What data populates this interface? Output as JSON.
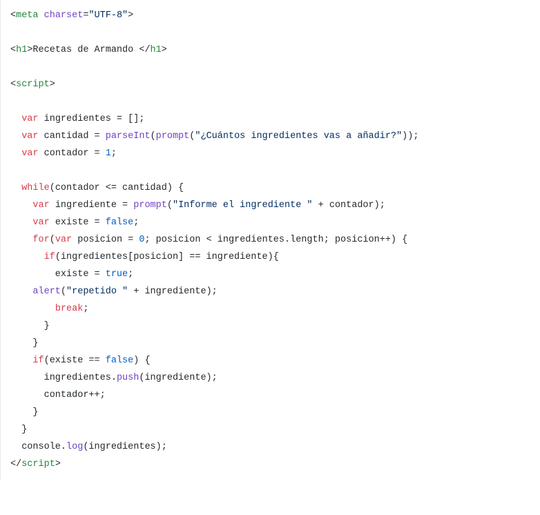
{
  "code": {
    "lines": [
      [
        {
          "c": "c-default",
          "t": "<"
        },
        {
          "c": "c-tag",
          "t": "meta"
        },
        {
          "c": "c-default",
          "t": " "
        },
        {
          "c": "c-attr",
          "t": "charset"
        },
        {
          "c": "c-default",
          "t": "="
        },
        {
          "c": "c-str",
          "t": "\"UTF-8\""
        },
        {
          "c": "c-default",
          "t": ">"
        }
      ],
      [],
      [
        {
          "c": "c-default",
          "t": "<"
        },
        {
          "c": "c-tag",
          "t": "h1"
        },
        {
          "c": "c-default",
          "t": ">Recetas de Armando </"
        },
        {
          "c": "c-tag",
          "t": "h1"
        },
        {
          "c": "c-default",
          "t": ">"
        }
      ],
      [],
      [
        {
          "c": "c-default",
          "t": "<"
        },
        {
          "c": "c-tag",
          "t": "script"
        },
        {
          "c": "c-default",
          "t": ">"
        }
      ],
      [],
      [
        {
          "c": "c-default",
          "t": "  "
        },
        {
          "c": "c-kw",
          "t": "var"
        },
        {
          "c": "c-default",
          "t": " ingredientes = [];"
        }
      ],
      [
        {
          "c": "c-default",
          "t": "  "
        },
        {
          "c": "c-kw",
          "t": "var"
        },
        {
          "c": "c-default",
          "t": " cantidad = "
        },
        {
          "c": "c-func",
          "t": "parseInt"
        },
        {
          "c": "c-default",
          "t": "("
        },
        {
          "c": "c-func",
          "t": "prompt"
        },
        {
          "c": "c-default",
          "t": "("
        },
        {
          "c": "c-str",
          "t": "\"¿Cuántos ingredientes vas a añadir?\""
        },
        {
          "c": "c-default",
          "t": "));"
        }
      ],
      [
        {
          "c": "c-default",
          "t": "  "
        },
        {
          "c": "c-kw",
          "t": "var"
        },
        {
          "c": "c-default",
          "t": " contador = "
        },
        {
          "c": "c-num",
          "t": "1"
        },
        {
          "c": "c-default",
          "t": ";"
        }
      ],
      [],
      [
        {
          "c": "c-default",
          "t": "  "
        },
        {
          "c": "c-kw",
          "t": "while"
        },
        {
          "c": "c-default",
          "t": "(contador <= cantidad) {"
        }
      ],
      [
        {
          "c": "c-default",
          "t": "    "
        },
        {
          "c": "c-kw",
          "t": "var"
        },
        {
          "c": "c-default",
          "t": " ingrediente = "
        },
        {
          "c": "c-func",
          "t": "prompt"
        },
        {
          "c": "c-default",
          "t": "("
        },
        {
          "c": "c-str",
          "t": "\"Informe el ingrediente \""
        },
        {
          "c": "c-default",
          "t": " + contador);"
        }
      ],
      [
        {
          "c": "c-default",
          "t": "    "
        },
        {
          "c": "c-kw",
          "t": "var"
        },
        {
          "c": "c-default",
          "t": " existe = "
        },
        {
          "c": "c-bool",
          "t": "false"
        },
        {
          "c": "c-default",
          "t": ";"
        }
      ],
      [
        {
          "c": "c-default",
          "t": "    "
        },
        {
          "c": "c-kw",
          "t": "for"
        },
        {
          "c": "c-default",
          "t": "("
        },
        {
          "c": "c-kw",
          "t": "var"
        },
        {
          "c": "c-default",
          "t": " posicion = "
        },
        {
          "c": "c-num",
          "t": "0"
        },
        {
          "c": "c-default",
          "t": "; posicion < ingredientes.length; posicion++) {"
        }
      ],
      [
        {
          "c": "c-default",
          "t": "      "
        },
        {
          "c": "c-kw",
          "t": "if"
        },
        {
          "c": "c-default",
          "t": "(ingredientes[posicion] == ingrediente){"
        }
      ],
      [
        {
          "c": "c-default",
          "t": "        existe = "
        },
        {
          "c": "c-bool",
          "t": "true"
        },
        {
          "c": "c-default",
          "t": ";"
        }
      ],
      [
        {
          "c": "c-default",
          "t": "    "
        },
        {
          "c": "c-func",
          "t": "alert"
        },
        {
          "c": "c-default",
          "t": "("
        },
        {
          "c": "c-str",
          "t": "\"repetido \""
        },
        {
          "c": "c-default",
          "t": " + ingrediente);"
        }
      ],
      [
        {
          "c": "c-default",
          "t": "        "
        },
        {
          "c": "c-kw",
          "t": "break"
        },
        {
          "c": "c-default",
          "t": ";"
        }
      ],
      [
        {
          "c": "c-default",
          "t": "      }"
        }
      ],
      [
        {
          "c": "c-default",
          "t": "    }"
        }
      ],
      [
        {
          "c": "c-default",
          "t": "    "
        },
        {
          "c": "c-kw",
          "t": "if"
        },
        {
          "c": "c-default",
          "t": "(existe == "
        },
        {
          "c": "c-bool",
          "t": "false"
        },
        {
          "c": "c-default",
          "t": ") {"
        }
      ],
      [
        {
          "c": "c-default",
          "t": "      ingredientes."
        },
        {
          "c": "c-func",
          "t": "push"
        },
        {
          "c": "c-default",
          "t": "(ingrediente);"
        }
      ],
      [
        {
          "c": "c-default",
          "t": "      contador++;"
        }
      ],
      [
        {
          "c": "c-default",
          "t": "    }"
        }
      ],
      [
        {
          "c": "c-default",
          "t": "  }"
        }
      ],
      [
        {
          "c": "c-default",
          "t": "  console."
        },
        {
          "c": "c-func",
          "t": "log"
        },
        {
          "c": "c-default",
          "t": "(ingredientes);"
        }
      ],
      [
        {
          "c": "c-default",
          "t": "</"
        },
        {
          "c": "c-tag",
          "t": "script"
        },
        {
          "c": "c-default",
          "t": ">"
        }
      ]
    ]
  }
}
